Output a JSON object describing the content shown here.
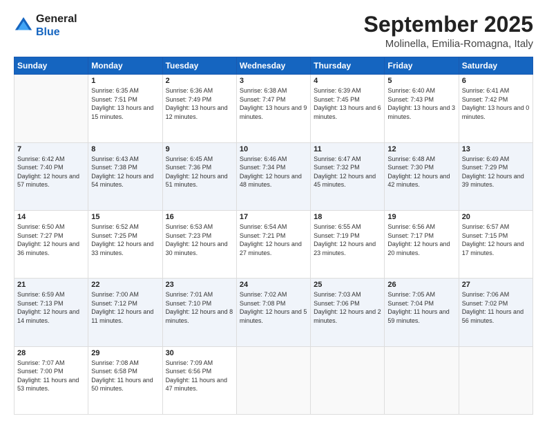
{
  "header": {
    "logo_line1": "General",
    "logo_line2": "Blue",
    "month_year": "September 2025",
    "location": "Molinella, Emilia-Romagna, Italy"
  },
  "days_of_week": [
    "Sunday",
    "Monday",
    "Tuesday",
    "Wednesday",
    "Thursday",
    "Friday",
    "Saturday"
  ],
  "weeks": [
    [
      {
        "day": "",
        "sunrise": "",
        "sunset": "",
        "daylight": ""
      },
      {
        "day": "1",
        "sunrise": "Sunrise: 6:35 AM",
        "sunset": "Sunset: 7:51 PM",
        "daylight": "Daylight: 13 hours and 15 minutes."
      },
      {
        "day": "2",
        "sunrise": "Sunrise: 6:36 AM",
        "sunset": "Sunset: 7:49 PM",
        "daylight": "Daylight: 13 hours and 12 minutes."
      },
      {
        "day": "3",
        "sunrise": "Sunrise: 6:38 AM",
        "sunset": "Sunset: 7:47 PM",
        "daylight": "Daylight: 13 hours and 9 minutes."
      },
      {
        "day": "4",
        "sunrise": "Sunrise: 6:39 AM",
        "sunset": "Sunset: 7:45 PM",
        "daylight": "Daylight: 13 hours and 6 minutes."
      },
      {
        "day": "5",
        "sunrise": "Sunrise: 6:40 AM",
        "sunset": "Sunset: 7:43 PM",
        "daylight": "Daylight: 13 hours and 3 minutes."
      },
      {
        "day": "6",
        "sunrise": "Sunrise: 6:41 AM",
        "sunset": "Sunset: 7:42 PM",
        "daylight": "Daylight: 13 hours and 0 minutes."
      }
    ],
    [
      {
        "day": "7",
        "sunrise": "Sunrise: 6:42 AM",
        "sunset": "Sunset: 7:40 PM",
        "daylight": "Daylight: 12 hours and 57 minutes."
      },
      {
        "day": "8",
        "sunrise": "Sunrise: 6:43 AM",
        "sunset": "Sunset: 7:38 PM",
        "daylight": "Daylight: 12 hours and 54 minutes."
      },
      {
        "day": "9",
        "sunrise": "Sunrise: 6:45 AM",
        "sunset": "Sunset: 7:36 PM",
        "daylight": "Daylight: 12 hours and 51 minutes."
      },
      {
        "day": "10",
        "sunrise": "Sunrise: 6:46 AM",
        "sunset": "Sunset: 7:34 PM",
        "daylight": "Daylight: 12 hours and 48 minutes."
      },
      {
        "day": "11",
        "sunrise": "Sunrise: 6:47 AM",
        "sunset": "Sunset: 7:32 PM",
        "daylight": "Daylight: 12 hours and 45 minutes."
      },
      {
        "day": "12",
        "sunrise": "Sunrise: 6:48 AM",
        "sunset": "Sunset: 7:30 PM",
        "daylight": "Daylight: 12 hours and 42 minutes."
      },
      {
        "day": "13",
        "sunrise": "Sunrise: 6:49 AM",
        "sunset": "Sunset: 7:29 PM",
        "daylight": "Daylight: 12 hours and 39 minutes."
      }
    ],
    [
      {
        "day": "14",
        "sunrise": "Sunrise: 6:50 AM",
        "sunset": "Sunset: 7:27 PM",
        "daylight": "Daylight: 12 hours and 36 minutes."
      },
      {
        "day": "15",
        "sunrise": "Sunrise: 6:52 AM",
        "sunset": "Sunset: 7:25 PM",
        "daylight": "Daylight: 12 hours and 33 minutes."
      },
      {
        "day": "16",
        "sunrise": "Sunrise: 6:53 AM",
        "sunset": "Sunset: 7:23 PM",
        "daylight": "Daylight: 12 hours and 30 minutes."
      },
      {
        "day": "17",
        "sunrise": "Sunrise: 6:54 AM",
        "sunset": "Sunset: 7:21 PM",
        "daylight": "Daylight: 12 hours and 27 minutes."
      },
      {
        "day": "18",
        "sunrise": "Sunrise: 6:55 AM",
        "sunset": "Sunset: 7:19 PM",
        "daylight": "Daylight: 12 hours and 23 minutes."
      },
      {
        "day": "19",
        "sunrise": "Sunrise: 6:56 AM",
        "sunset": "Sunset: 7:17 PM",
        "daylight": "Daylight: 12 hours and 20 minutes."
      },
      {
        "day": "20",
        "sunrise": "Sunrise: 6:57 AM",
        "sunset": "Sunset: 7:15 PM",
        "daylight": "Daylight: 12 hours and 17 minutes."
      }
    ],
    [
      {
        "day": "21",
        "sunrise": "Sunrise: 6:59 AM",
        "sunset": "Sunset: 7:13 PM",
        "daylight": "Daylight: 12 hours and 14 minutes."
      },
      {
        "day": "22",
        "sunrise": "Sunrise: 7:00 AM",
        "sunset": "Sunset: 7:12 PM",
        "daylight": "Daylight: 12 hours and 11 minutes."
      },
      {
        "day": "23",
        "sunrise": "Sunrise: 7:01 AM",
        "sunset": "Sunset: 7:10 PM",
        "daylight": "Daylight: 12 hours and 8 minutes."
      },
      {
        "day": "24",
        "sunrise": "Sunrise: 7:02 AM",
        "sunset": "Sunset: 7:08 PM",
        "daylight": "Daylight: 12 hours and 5 minutes."
      },
      {
        "day": "25",
        "sunrise": "Sunrise: 7:03 AM",
        "sunset": "Sunset: 7:06 PM",
        "daylight": "Daylight: 12 hours and 2 minutes."
      },
      {
        "day": "26",
        "sunrise": "Sunrise: 7:05 AM",
        "sunset": "Sunset: 7:04 PM",
        "daylight": "Daylight: 11 hours and 59 minutes."
      },
      {
        "day": "27",
        "sunrise": "Sunrise: 7:06 AM",
        "sunset": "Sunset: 7:02 PM",
        "daylight": "Daylight: 11 hours and 56 minutes."
      }
    ],
    [
      {
        "day": "28",
        "sunrise": "Sunrise: 7:07 AM",
        "sunset": "Sunset: 7:00 PM",
        "daylight": "Daylight: 11 hours and 53 minutes."
      },
      {
        "day": "29",
        "sunrise": "Sunrise: 7:08 AM",
        "sunset": "Sunset: 6:58 PM",
        "daylight": "Daylight: 11 hours and 50 minutes."
      },
      {
        "day": "30",
        "sunrise": "Sunrise: 7:09 AM",
        "sunset": "Sunset: 6:56 PM",
        "daylight": "Daylight: 11 hours and 47 minutes."
      },
      {
        "day": "",
        "sunrise": "",
        "sunset": "",
        "daylight": ""
      },
      {
        "day": "",
        "sunrise": "",
        "sunset": "",
        "daylight": ""
      },
      {
        "day": "",
        "sunrise": "",
        "sunset": "",
        "daylight": ""
      },
      {
        "day": "",
        "sunrise": "",
        "sunset": "",
        "daylight": ""
      }
    ]
  ]
}
